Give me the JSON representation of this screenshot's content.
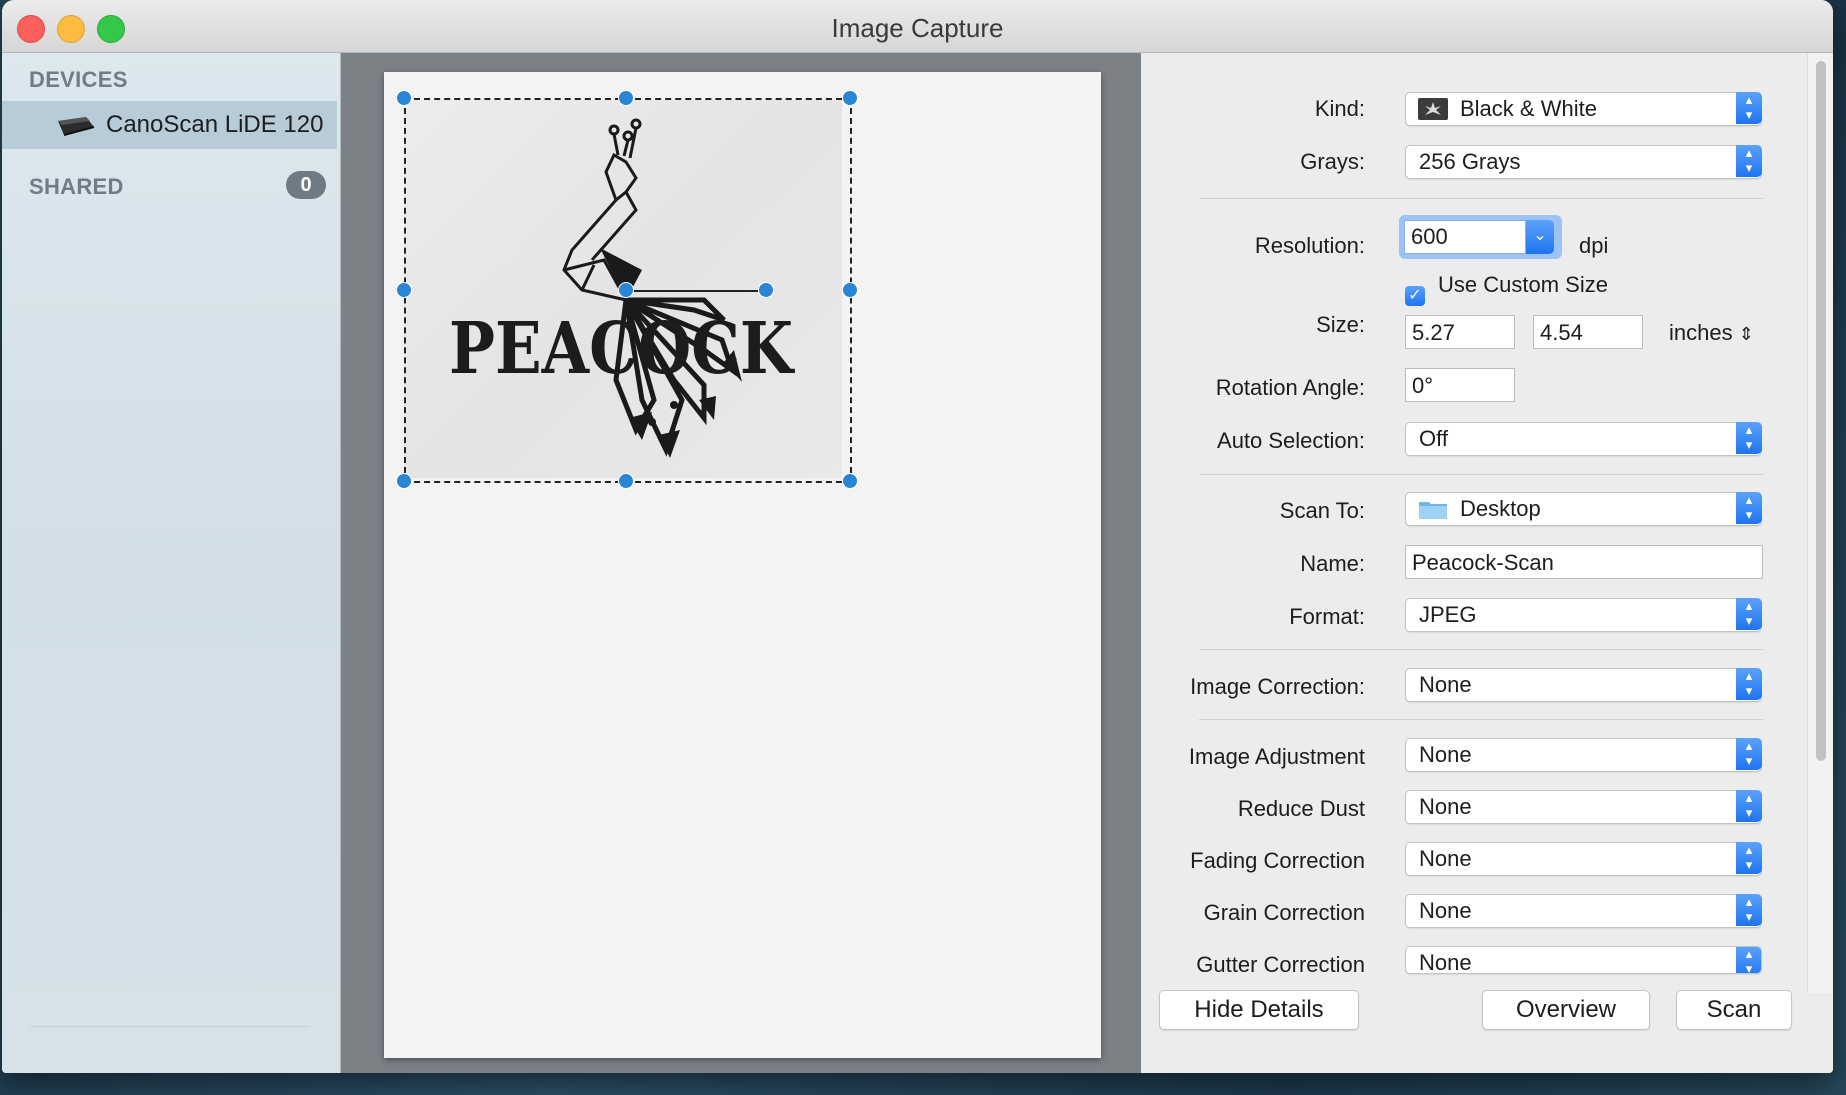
{
  "window": {
    "title": "Image Capture"
  },
  "sidebar": {
    "devices_header": "DEVICES",
    "device_name": "CanoScan LiDE 120",
    "shared_header": "SHARED",
    "shared_count": "0"
  },
  "preview": {
    "scan_text": "PEACOCK"
  },
  "details": {
    "kind": {
      "label": "Kind:",
      "value": "Black & White"
    },
    "grays": {
      "label": "Grays:",
      "value": "256 Grays"
    },
    "resolution": {
      "label": "Resolution:",
      "value": "600",
      "unit": "dpi"
    },
    "custom_size": {
      "label": "Use Custom Size",
      "checked": true
    },
    "size": {
      "label": "Size:",
      "width": "5.27",
      "height": "4.54",
      "unit": "inches"
    },
    "rotation": {
      "label": "Rotation Angle:",
      "value": "0°"
    },
    "auto_selection": {
      "label": "Auto Selection:",
      "value": "Off"
    },
    "scan_to": {
      "label": "Scan To:",
      "value": "Desktop"
    },
    "name": {
      "label": "Name:",
      "value": "Peacock-Scan"
    },
    "format": {
      "label": "Format:",
      "value": "JPEG"
    },
    "image_correction": {
      "label": "Image Correction:",
      "value": "None"
    },
    "image_adjustment": {
      "label": "Image Adjustment",
      "value": "None"
    },
    "reduce_dust": {
      "label": "Reduce Dust",
      "value": "None"
    },
    "fading_correction": {
      "label": "Fading Correction",
      "value": "None"
    },
    "grain_correction": {
      "label": "Grain Correction",
      "value": "None"
    },
    "gutter_correction": {
      "label": "Gutter Correction",
      "value": "None"
    }
  },
  "buttons": {
    "hide_details": "Hide Details",
    "overview": "Overview",
    "scan": "Scan"
  },
  "colors": {
    "accent": "#1f74f0",
    "handle": "#2a85d4",
    "badge": "#707a82"
  }
}
